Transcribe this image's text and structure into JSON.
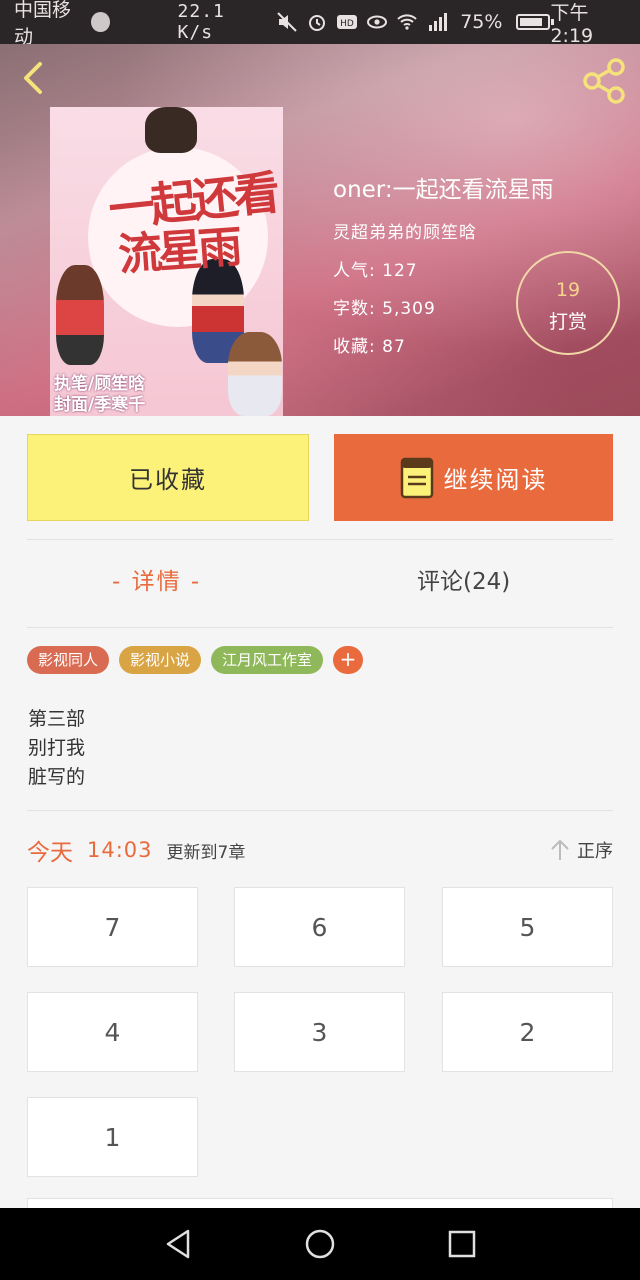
{
  "status_bar": {
    "carrier": "中国移动",
    "speed": "22.1 K/s",
    "network": "4G",
    "battery": "75%",
    "time": "下午2:19"
  },
  "header": {
    "book_title": "oner:一起还看流星雨",
    "author": "灵超弟弟的顾笙晗",
    "popularity": "人气: 127",
    "word_count": "字数: 5,309",
    "favorites": "收藏: 87",
    "reward_count": "19",
    "reward_label": "打赏",
    "cover": {
      "title_line1": "一起还看",
      "title_line2": "流星雨",
      "author_line1": "执笔/顾笙晗",
      "author_line2": "封面/季寒千"
    }
  },
  "actions": {
    "collected_label": "已收藏",
    "continue_label": "继续阅读"
  },
  "tabs": {
    "detail": "- 详情 -",
    "comments": "评论(24)"
  },
  "tags": [
    {
      "label": "影视同人",
      "color": "#d96b52"
    },
    {
      "label": "影视小说",
      "color": "#d9a443"
    },
    {
      "label": "江月风工作室",
      "color": "#8fb85a"
    }
  ],
  "tag_add_label": "+",
  "description": [
    "第三部",
    "别打我",
    "脏写的"
  ],
  "update": {
    "day": "今天",
    "time": "14:03",
    "text": "更新到7章",
    "sort_label": "正序"
  },
  "chapters": [
    "7",
    "6",
    "5",
    "4",
    "3",
    "2",
    "1"
  ],
  "colors": {
    "accent": "#e96a3d",
    "collected_bg": "#fcf27a",
    "reward_number": "#f6d48c"
  }
}
